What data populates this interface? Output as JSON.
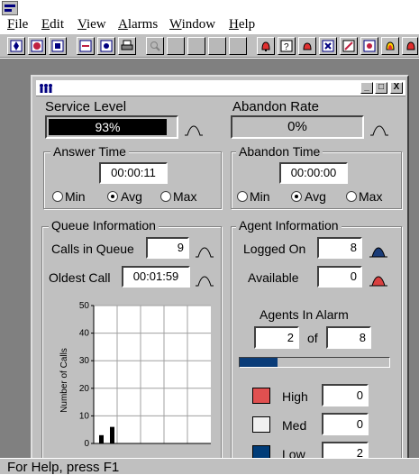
{
  "menubar": {
    "items": [
      {
        "label": "File",
        "mnemonic": "F",
        "rest": "ile"
      },
      {
        "label": "Edit",
        "mnemonic": "E",
        "rest": "dit"
      },
      {
        "label": "View",
        "mnemonic": "V",
        "rest": "iew"
      },
      {
        "label": "Alarms",
        "mnemonic": "A",
        "rest": "larms"
      },
      {
        "label": "Window",
        "mnemonic": "W",
        "rest": "indow"
      },
      {
        "label": "Help",
        "mnemonic": "H",
        "rest": "elp"
      }
    ]
  },
  "toolbar": {
    "buttons": [
      {
        "icon": "move-icon",
        "enabled": true
      },
      {
        "icon": "cycle-icon",
        "enabled": true
      },
      {
        "icon": "network-icon",
        "enabled": true
      },
      {
        "icon": "disconnect-icon",
        "enabled": true
      },
      {
        "icon": "settings-icon",
        "enabled": true
      },
      {
        "icon": "print-icon",
        "enabled": true
      },
      {
        "icon": "zoom-icon",
        "enabled": false
      },
      {
        "icon": "blank-icon",
        "enabled": false
      },
      {
        "icon": "blank-icon",
        "enabled": false
      },
      {
        "icon": "blank-icon",
        "enabled": false
      },
      {
        "icon": "blank-icon",
        "enabled": false
      },
      {
        "icon": "alarm-bell-icon",
        "enabled": true
      },
      {
        "icon": "alarm-query-icon",
        "enabled": true
      },
      {
        "icon": "alarm-trigger-icon",
        "enabled": true
      },
      {
        "icon": "alarm-network-icon",
        "enabled": true
      },
      {
        "icon": "alarm-edit-icon",
        "enabled": true
      },
      {
        "icon": "alarm-disconnect-icon",
        "enabled": true
      },
      {
        "icon": "alarm-active-icon",
        "enabled": true
      },
      {
        "icon": "alarm-clear-icon",
        "enabled": true
      }
    ]
  },
  "child_window": {
    "icon": "agents-icon",
    "controls": {
      "minimize": "_",
      "maximize": "□",
      "close": "X"
    }
  },
  "service_level": {
    "label": "Service Level",
    "value": "93%"
  },
  "abandon_rate": {
    "label": "Abandon Rate",
    "value": "0%"
  },
  "answer_time": {
    "title": "Answer Time",
    "value": "00:00:11",
    "options": [
      "Min",
      "Avg",
      "Max"
    ],
    "selected": "Avg"
  },
  "abandon_time": {
    "title": "Abandon Time",
    "value": "00:00:00",
    "options": [
      "Min",
      "Avg",
      "Max"
    ],
    "selected": "Avg"
  },
  "queue_info": {
    "title": "Queue Information",
    "calls_label": "Calls in Queue",
    "calls_value": "9",
    "oldest_label": "Oldest Call",
    "oldest_value": "00:01:59"
  },
  "agent_info": {
    "title": "Agent Information",
    "logged_label": "Logged On",
    "logged_value": "8",
    "available_label": "Available",
    "available_value": "0",
    "alarm_title": "Agents In Alarm",
    "alarm_count": "2",
    "of_label": "of",
    "alarm_total": "8",
    "alarm_fraction": 0.25,
    "legend": [
      {
        "label": "High",
        "value": "0",
        "color": "#e05050"
      },
      {
        "label": "Med",
        "value": "0",
        "color": "#f0f0f0"
      },
      {
        "label": "Low",
        "value": "2",
        "color": "#003c78"
      }
    ]
  },
  "colors": {
    "bell_blue": "#1a3c78",
    "bell_red": "#d94040",
    "bell_outline": "#000000",
    "progress_fill": "#0a3c78"
  },
  "chart_data": {
    "type": "bar",
    "ylabel": "Number of Calls",
    "ylim": [
      0,
      50
    ],
    "yticks": [
      0,
      10,
      20,
      30,
      40,
      50
    ],
    "values": [
      3,
      6
    ],
    "grid": true
  },
  "status": {
    "text": "For Help, press F1"
  }
}
